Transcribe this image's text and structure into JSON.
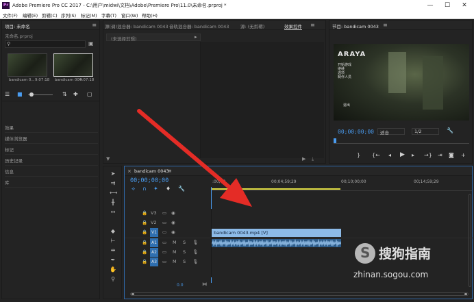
{
  "window": {
    "title": "Adobe Premiere Pro CC 2017 - C:\\用户\\midwi\\文档\\Adobe\\Premiere Pro\\11.0\\未命名.prproj *",
    "app_icon_text": "Pr",
    "minimize": "—",
    "maximize": "☐",
    "close": "✕"
  },
  "menu": [
    "文件(F)",
    "编辑(E)",
    "剪辑(C)",
    "序列(S)",
    "标记(M)",
    "字幕(T)",
    "窗口(W)",
    "帮助(H)"
  ],
  "project": {
    "tab": "项目: 未命名",
    "file": "未命名.prproj",
    "clips": [
      {
        "name": "bandicam 0...",
        "duration": "9:07:18"
      },
      {
        "name": "bandicam 004...",
        "duration": "9:07:18"
      }
    ],
    "rows": [
      "效果",
      "媒体浏览器",
      "标记",
      "历史记录",
      "信息",
      "库"
    ]
  },
  "source": {
    "tabs": [
      "源(调)混合器: bandicam 0043",
      "音轨混合器: bandicam 0043",
      "源: (无剪辑)",
      "效果控件"
    ],
    "placeholder": "(未选择剪辑)"
  },
  "program": {
    "tab": "节目: bandicam 0043",
    "timecode": "00;00;00;00",
    "fit": "适合",
    "resolution": "1/2",
    "overlay": {
      "title": "ARAYA",
      "menu": [
        "开始游戏",
        "继续",
        "选项",
        "制作人员"
      ],
      "exit": "退出"
    }
  },
  "timeline": {
    "sequence": "bandicam 0043",
    "timecode": "00;00;00;00",
    "ruler": [
      ":00;00",
      "00;04;59;29",
      "00;10;00;00",
      "00;14;59;29"
    ],
    "tracks": [
      {
        "id": "V3",
        "type": "video"
      },
      {
        "id": "V2",
        "type": "video"
      },
      {
        "id": "V1",
        "type": "video",
        "target": true
      },
      {
        "id": "A1",
        "type": "audio",
        "target": true
      },
      {
        "id": "A2",
        "type": "audio",
        "target": true
      },
      {
        "id": "A3",
        "type": "audio",
        "target": true
      }
    ],
    "track_labels": {
      "mute": "M",
      "solo": "S"
    },
    "master_level": "0.0",
    "video_clip": "bandicam 0043.mp4 [V]",
    "colors": {
      "video_clip": "#8dbbe8",
      "audio_clip": "#2d5c8a",
      "playhead": "#4a9cf0",
      "work_area": "#e3e047"
    }
  },
  "annotation": {
    "color": "#e42c26"
  },
  "watermark": {
    "brand": "搜狗指南",
    "url": "zhinan.sogou.com"
  }
}
